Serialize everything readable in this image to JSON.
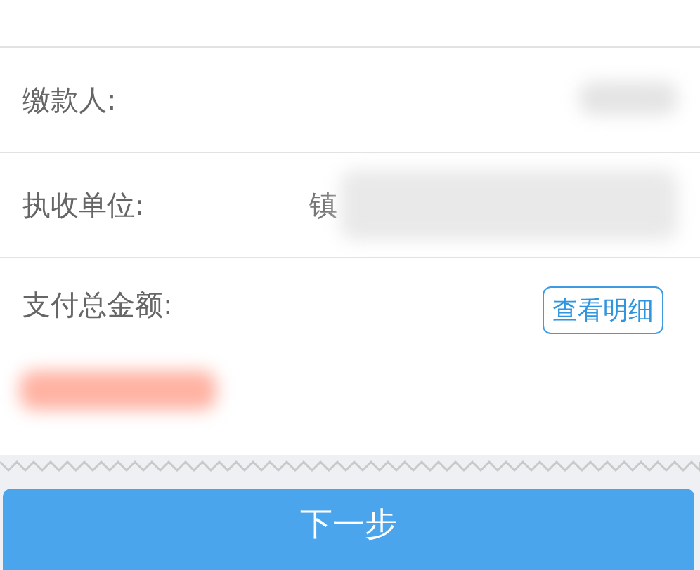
{
  "fields": [
    {
      "label": "缴款人:"
    },
    {
      "label": "执收单位:",
      "value": "镇"
    }
  ],
  "total": {
    "label": "支付总金额:",
    "detail_button": "查看明细"
  },
  "next_button": "下一步"
}
